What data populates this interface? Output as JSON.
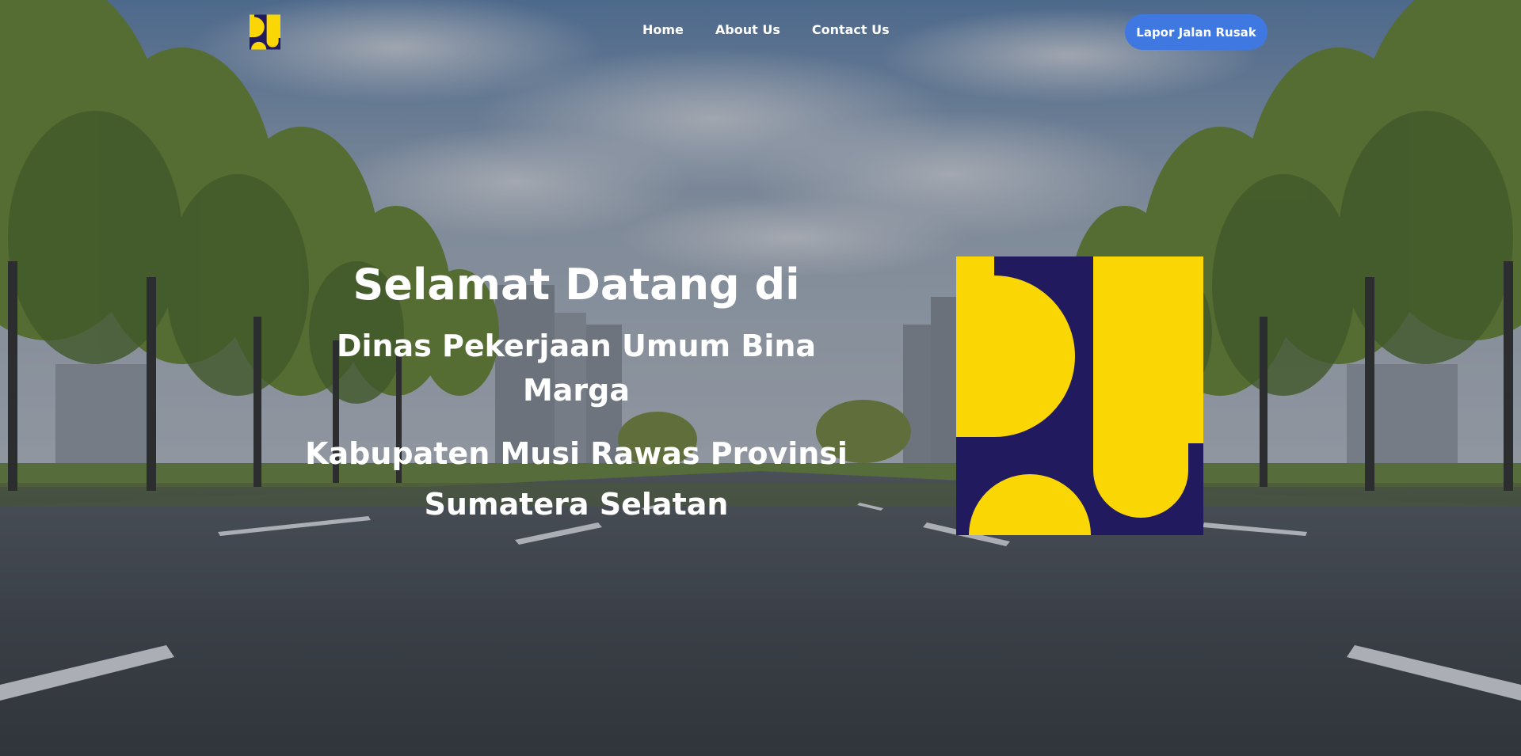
{
  "nav": {
    "logo_icon": "pu-logo-icon",
    "links": [
      {
        "label": "Home"
      },
      {
        "label": "About Us"
      },
      {
        "label": "Contact Us"
      }
    ],
    "cta_label": "Lapor Jalan Rusak"
  },
  "hero": {
    "title": "Selamat Datang di",
    "subtitle": "Dinas Pekerjaan Umum Bina Marga",
    "region": "Kabupaten Musi Rawas Provinsi Sumatera Selatan",
    "logo_icon": "pu-logo-icon"
  },
  "colors": {
    "logo_navy": "#221a5e",
    "logo_yellow": "#fbd605",
    "cta_blue": "#3f78e0",
    "text": "#ffffff"
  }
}
